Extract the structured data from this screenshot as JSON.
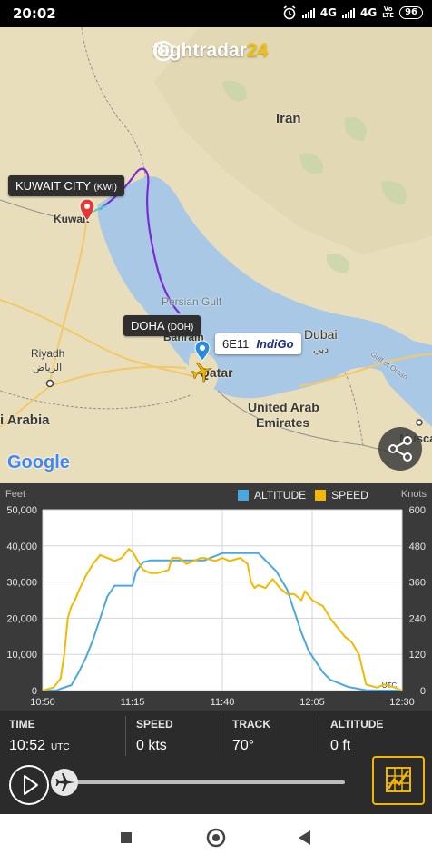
{
  "status_bar": {
    "time": "20:02",
    "network_1": "4G",
    "network_2": "4G",
    "volte_top": "Vo",
    "volte_bottom": "LTE",
    "battery": "96"
  },
  "map": {
    "brand": {
      "main": "flightradar",
      "accent": "24"
    },
    "labels": {
      "iran": "Iran",
      "kuwait": "Kuwait",
      "persian_gulf": "Persian Gulf",
      "bahrain": "Bahrain",
      "qatar": "Qatar",
      "dubai": "Dubai",
      "dubai_ar": "دبي",
      "riyadh": "Riyadh",
      "riyadh_ar": "الرياض",
      "saudi": "i Arabia",
      "uae_1": "United Arab",
      "uae_2": "Emirates",
      "gulf_oman": "Gulf of Oman",
      "muscat": "Musca"
    },
    "origin": {
      "city": "KUWAIT CITY",
      "code": "(KWI)"
    },
    "destination": {
      "city": "DOHA",
      "code": "(DOH)"
    },
    "flight": {
      "number": "6E11",
      "airline": "IndiGo"
    },
    "attribution": "Google",
    "colors": {
      "land": "#e9dfbe",
      "water": "#a9c8e6",
      "route": "#7b2bd6",
      "plane": "#f2b600"
    }
  },
  "chart_panel": {
    "left_unit": "Feet",
    "right_unit": "Knots",
    "legend_altitude": "ALTITUDE",
    "legend_speed": "SPEED"
  },
  "chart_data": {
    "type": "line",
    "x_ticks": [
      "10:50",
      "11:15",
      "11:40",
      "12:05",
      "12:30"
    ],
    "y_left_ticks": [
      "50,000",
      "40,000",
      "30,000",
      "20,000",
      "10,000",
      "0"
    ],
    "y_right_ticks": [
      "600",
      "480",
      "360",
      "240",
      "120",
      "0"
    ],
    "y_left_range": [
      0,
      50000
    ],
    "y_right_range": [
      0,
      600
    ],
    "x_range_minutes": [
      0,
      100
    ],
    "utc_label": "UTC",
    "series": [
      {
        "name": "ALTITUDE",
        "axis": "left",
        "color": "#4aa8e0",
        "x": [
          0,
          2,
          4,
          5,
          8,
          10,
          12,
          14,
          16,
          18,
          20,
          22,
          25,
          26,
          28,
          30,
          35,
          40,
          45,
          50,
          53,
          56,
          60,
          62,
          65,
          68,
          70,
          72,
          74,
          76,
          78,
          80,
          85,
          90,
          95,
          100
        ],
        "y": [
          0,
          0,
          100,
          500,
          1500,
          5000,
          9000,
          14000,
          20000,
          26000,
          29000,
          29000,
          29000,
          33000,
          35500,
          36000,
          36000,
          36000,
          36000,
          38000,
          38000,
          38000,
          38000,
          36000,
          33000,
          28000,
          22000,
          16000,
          11000,
          8000,
          5000,
          3000,
          1000,
          100,
          0,
          0
        ]
      },
      {
        "name": "SPEED",
        "axis": "right",
        "color": "#f5b800",
        "x": [
          0,
          3,
          5,
          6,
          7,
          8,
          9,
          10,
          12,
          14,
          16,
          18,
          20,
          22,
          24,
          25,
          26,
          27,
          28,
          30,
          32,
          35,
          36,
          38,
          40,
          42,
          44,
          45,
          48,
          50,
          52,
          55,
          57,
          58,
          59,
          60,
          62,
          64,
          66,
          68,
          70,
          72,
          73,
          75,
          78,
          80,
          82,
          84,
          86,
          88,
          90,
          93,
          95,
          98,
          100
        ],
        "y": [
          0,
          10,
          40,
          120,
          240,
          280,
          300,
          330,
          380,
          420,
          450,
          440,
          430,
          440,
          470,
          460,
          440,
          420,
          400,
          390,
          390,
          400,
          440,
          440,
          420,
          430,
          440,
          440,
          430,
          440,
          430,
          440,
          420,
          360,
          340,
          350,
          340,
          370,
          340,
          320,
          320,
          300,
          330,
          300,
          280,
          240,
          210,
          180,
          160,
          120,
          20,
          10,
          20,
          10,
          0
        ]
      }
    ]
  },
  "info": {
    "time_label": "TIME",
    "time_value": "10:52",
    "time_unit": "UTC",
    "speed_label": "SPEED",
    "speed_value": "0 kts",
    "track_label": "TRACK",
    "track_value": "70°",
    "altitude_label": "ALTITUDE",
    "altitude_value": "0 ft"
  },
  "playback": {
    "progress": 0.0
  },
  "nav": {
    "back_icon": "triangle-back",
    "home_icon": "circle-home",
    "recents_icon": "square-recents"
  }
}
